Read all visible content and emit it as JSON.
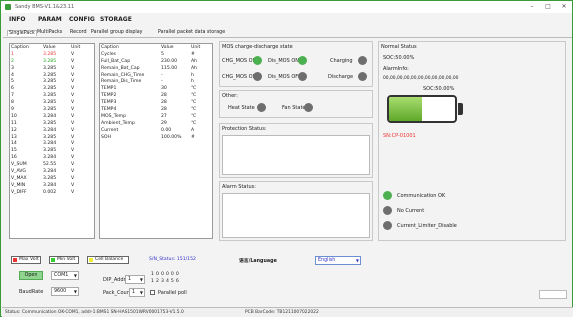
{
  "window": {
    "title": "Sandy BMS-V1.1&23.11"
  },
  "menu": [
    "INFO",
    "PARAM",
    "CONFIG",
    "STORAGE"
  ],
  "tabs": [
    "SinglePack",
    "MultiPacks",
    "Record",
    "Parallel group display",
    "Parallel packet data storage"
  ],
  "cells": {
    "headers": [
      "Caption",
      "Value",
      "Unit"
    ],
    "rows": [
      {
        "caption": "1",
        "value": "3.285",
        "unit": "V"
      },
      {
        "caption": "2",
        "value": "3.285",
        "unit": "V"
      },
      {
        "caption": "3",
        "value": "3.285",
        "unit": "V"
      },
      {
        "caption": "4",
        "value": "3.285",
        "unit": "V"
      },
      {
        "caption": "5",
        "value": "3.285",
        "unit": "V"
      },
      {
        "caption": "6",
        "value": "3.285",
        "unit": "V"
      },
      {
        "caption": "7",
        "value": "3.285",
        "unit": "V"
      },
      {
        "caption": "8",
        "value": "3.285",
        "unit": "V"
      },
      {
        "caption": "9",
        "value": "3.285",
        "unit": "V"
      },
      {
        "caption": "10",
        "value": "3.284",
        "unit": "V"
      },
      {
        "caption": "11",
        "value": "3.285",
        "unit": "V"
      },
      {
        "caption": "12",
        "value": "3.284",
        "unit": "V"
      },
      {
        "caption": "13",
        "value": "3.285",
        "unit": "V"
      },
      {
        "caption": "14",
        "value": "3.284",
        "unit": "V"
      },
      {
        "caption": "15",
        "value": "3.285",
        "unit": "V"
      },
      {
        "caption": "16",
        "value": "3.284",
        "unit": "V"
      },
      {
        "caption": "V_SUM",
        "value": "52.55",
        "unit": "V"
      },
      {
        "caption": "V_AVG",
        "value": "3.284",
        "unit": "V"
      },
      {
        "caption": "V_MAX",
        "value": "3.285",
        "unit": "V"
      },
      {
        "caption": "V_MIN",
        "value": "3.284",
        "unit": "V"
      },
      {
        "caption": "V_DIFF",
        "value": "0.002",
        "unit": "V"
      }
    ]
  },
  "pack": {
    "headers": [
      "Caption",
      "Value",
      "Unit"
    ],
    "rows": [
      {
        "caption": "Cycles",
        "value": "5",
        "unit": "#"
      },
      {
        "caption": "Full_Bat_Cap",
        "value": "230.00",
        "unit": "Ah"
      },
      {
        "caption": "Remain_Bat_Cap",
        "value": "115.00",
        "unit": "Ah"
      },
      {
        "caption": "Remain_CHG_Time",
        "value": "-",
        "unit": "h"
      },
      {
        "caption": "Remain_Dis_Time",
        "value": "-",
        "unit": "h"
      },
      {
        "caption": "TEMP1",
        "value": "30",
        "unit": "℃"
      },
      {
        "caption": "TEMP2",
        "value": "28",
        "unit": "℃"
      },
      {
        "caption": "TEMP3",
        "value": "28",
        "unit": "℃"
      },
      {
        "caption": "TEMP4",
        "value": "28",
        "unit": "℃"
      },
      {
        "caption": "MOS_Temp",
        "value": "27",
        "unit": "℃"
      },
      {
        "caption": "Ambient_Temp",
        "value": "29",
        "unit": "℃"
      },
      {
        "caption": "Current",
        "value": "0.00",
        "unit": "A"
      },
      {
        "caption": "SOH",
        "value": "100.00%",
        "unit": "#"
      }
    ]
  },
  "mos": {
    "title": "MOS charge-discharge state",
    "chg_on": "CHG_MOS ON",
    "dis_on": "Dis_MOS ON",
    "charging": "Charging",
    "chg_off": "CHG_MOS OFF",
    "dis_off": "Dis_MOS OFF",
    "discharge": "Discharge"
  },
  "other": {
    "title": "Other:",
    "heat": "Heat State",
    "fan": "Fan State"
  },
  "protection": {
    "title": "Protection Status:"
  },
  "alarm": {
    "title": "Alarm Status:"
  },
  "normal": {
    "title": "Normal Status",
    "soc_top": "SOC:50.00%",
    "alarm_info": "AlarmInfo:",
    "hex": "00,00,00,00,00,00,00,00,00,00,00",
    "soc_label": "SOC:50.00%",
    "id": "SN:CP-01001"
  },
  "status_leds": {
    "comm": "Communication OK",
    "no_current": "No Current",
    "limiter": "Current_Limiter_Disable"
  },
  "legend": {
    "max_volt": "Max Volt",
    "min_volt": "Min Volt",
    "cell_balance": "Cell Balance",
    "sn_status": "S/N_Status: 151/152",
    "language_label": "语言/Language",
    "language_value": "English"
  },
  "port": {
    "open_btn": "Open",
    "com_value": "COM1",
    "baud_label": "BaudRate",
    "baud_value": "9600",
    "dip_label": "DIP_Addr",
    "dip_value": "1",
    "pack_label": "Pack_Count",
    "pack_value": "1",
    "parallel": "Parallel poll",
    "dip_row1": "1 0 0 0 0 0",
    "dip_row2": "1 2 3 4 5 6"
  },
  "statusbar": {
    "left": "Status: Communication OK-COM1, addr-1:BMS1 SN-HAS1501WRV0001753-V1.5.0",
    "right": "PCB BarCode: TB1211007022022"
  },
  "colors": {
    "accent": "#3a9b3a",
    "battery": "#7bc043",
    "sn": "#d9232d"
  }
}
